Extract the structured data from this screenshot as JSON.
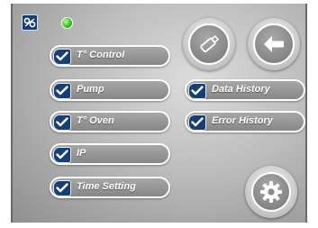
{
  "status": {
    "indicator_color": "#38c21f"
  },
  "left_menu": [
    {
      "label": "T° Control",
      "checked": true
    },
    {
      "label": "Pump",
      "checked": true
    },
    {
      "label": "T° Oven",
      "checked": true
    },
    {
      "label": "IP",
      "checked": true
    },
    {
      "label": "Time Setting",
      "checked": true
    }
  ],
  "right_menu": [
    {
      "label": "Data History",
      "checked": true
    },
    {
      "label": "Error History",
      "checked": true
    }
  ],
  "icons": {
    "logo": "company-logo-icon",
    "usb": "usb-stick-icon",
    "back": "arrow-left-icon",
    "settings": "gear-icon",
    "check": "checkmark-icon"
  },
  "colors": {
    "check_badge": "#173f73",
    "pill": "#959595",
    "background": "#bdbdbd"
  }
}
